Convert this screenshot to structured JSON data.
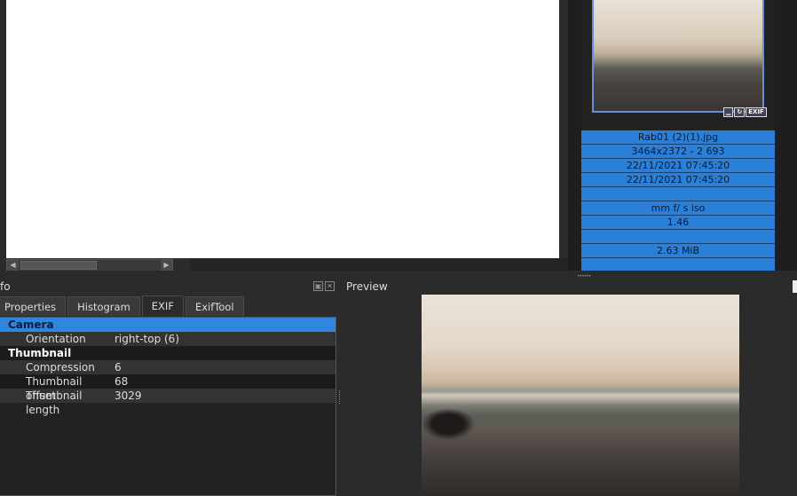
{
  "thumbnail": {
    "icons": [
      "minimize-icon",
      "rotate-icon",
      "exif-badge"
    ],
    "exif_badge": "EXIF"
  },
  "file_info": [
    "Rab01 (2)(1).jpg",
    "3464x2372 - 2 693",
    "22/11/2021 07:45:20",
    "22/11/2021 07:45:20",
    "",
    "mm f/ s iso",
    "1.46",
    "",
    "2.63 MiB",
    ""
  ],
  "info_panel": {
    "title": "fo",
    "tabs": [
      "Properties",
      "Histogram",
      "EXIF",
      "ExifTool"
    ],
    "active_tab": "EXIF"
  },
  "exif": {
    "group1": "Camera",
    "rows1": [
      {
        "key": "Orientation",
        "value": "right-top (6)"
      }
    ],
    "group2": "Thumbnail",
    "rows2": [
      {
        "key": "Compression",
        "value": "6"
      },
      {
        "key": "Thumbnail offset",
        "value": "68"
      },
      {
        "key": "Thumbnail length",
        "value": "3029"
      }
    ]
  },
  "preview": {
    "title": "Preview"
  },
  "colors": {
    "accent": "#2a7fd8",
    "background": "#2b2b2b"
  }
}
